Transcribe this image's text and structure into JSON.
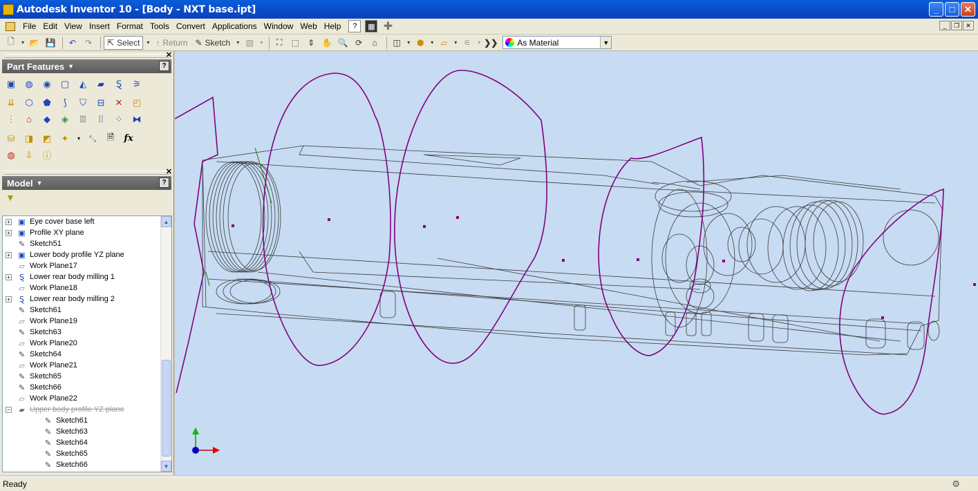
{
  "window": {
    "title": "Autodesk Inventor 10 - [Body - NXT base.ipt]",
    "buttons": {
      "minimize": "_",
      "maximize": "□",
      "close": "✕"
    }
  },
  "menubar": {
    "items": [
      "File",
      "Edit",
      "View",
      "Insert",
      "Format",
      "Tools",
      "Convert",
      "Applications",
      "Window",
      "Web",
      "Help"
    ]
  },
  "toolbar": {
    "select_label": "Select",
    "return_label": "Return",
    "sketch_label": "Sketch",
    "material_value": "As Material"
  },
  "part_features": {
    "title": "Part Features",
    "help": "?",
    "fx_label": "fx"
  },
  "model_browser": {
    "title": "Model",
    "help": "?",
    "items": [
      {
        "label": "Eye cover base left",
        "expander": "+",
        "icon": "extrude-feature-icon",
        "suppressed": false,
        "level": 0
      },
      {
        "label": "Profile XY plane",
        "expander": "+",
        "icon": "extrude-feature-icon",
        "suppressed": false,
        "level": 0
      },
      {
        "label": "Sketch51",
        "expander": "",
        "icon": "sketch-icon",
        "suppressed": false,
        "level": 0
      },
      {
        "label": "Lower body profile YZ plane",
        "expander": "+",
        "icon": "extrude-feature-icon",
        "suppressed": false,
        "level": 0
      },
      {
        "label": "Work Plane17",
        "expander": "",
        "icon": "work-plane-icon",
        "suppressed": false,
        "level": 0
      },
      {
        "label": "Lower rear body milling 1",
        "expander": "+",
        "icon": "sweep-feature-icon",
        "suppressed": false,
        "level": 0
      },
      {
        "label": "Work Plane18",
        "expander": "",
        "icon": "work-plane-icon",
        "suppressed": false,
        "level": 0
      },
      {
        "label": "Lower rear body milling 2",
        "expander": "+",
        "icon": "sweep-feature-icon",
        "suppressed": false,
        "level": 0
      },
      {
        "label": "Sketch61",
        "expander": "",
        "icon": "sketch-icon",
        "suppressed": false,
        "level": 0
      },
      {
        "label": "Work Plane19",
        "expander": "",
        "icon": "work-plane-icon",
        "suppressed": false,
        "level": 0
      },
      {
        "label": "Sketch63",
        "expander": "",
        "icon": "sketch-icon",
        "suppressed": false,
        "level": 0
      },
      {
        "label": "Work Plane20",
        "expander": "",
        "icon": "work-plane-icon",
        "suppressed": false,
        "level": 0
      },
      {
        "label": "Sketch64",
        "expander": "",
        "icon": "sketch-icon",
        "suppressed": false,
        "level": 0
      },
      {
        "label": "Work Plane21",
        "expander": "",
        "icon": "work-plane-icon",
        "suppressed": false,
        "level": 0
      },
      {
        "label": "Sketch65",
        "expander": "",
        "icon": "sketch-icon",
        "suppressed": false,
        "level": 0
      },
      {
        "label": "Sketch66",
        "expander": "",
        "icon": "sketch-icon",
        "suppressed": false,
        "level": 0
      },
      {
        "label": "Work Plane22",
        "expander": "",
        "icon": "work-plane-icon",
        "suppressed": false,
        "level": 0
      },
      {
        "label": "Upper body profile YZ plane",
        "expander": "−",
        "icon": "loft-feature-icon",
        "suppressed": true,
        "level": 0
      },
      {
        "label": "Sketch61",
        "expander": "",
        "icon": "sketch-icon",
        "suppressed": false,
        "level": 1
      },
      {
        "label": "Sketch63",
        "expander": "",
        "icon": "sketch-icon",
        "suppressed": false,
        "level": 1
      },
      {
        "label": "Sketch64",
        "expander": "",
        "icon": "sketch-icon",
        "suppressed": false,
        "level": 1
      },
      {
        "label": "Sketch65",
        "expander": "",
        "icon": "sketch-icon",
        "suppressed": false,
        "level": 1
      },
      {
        "label": "Sketch66",
        "expander": "",
        "icon": "sketch-icon",
        "suppressed": false,
        "level": 1
      }
    ]
  },
  "status": {
    "text": "Ready"
  },
  "colors": {
    "titlebar": "#0b4fd0",
    "viewport_bg": "#c7dbf2",
    "sketch_profile": "#800080",
    "wireframe": "#3a3a3a"
  }
}
